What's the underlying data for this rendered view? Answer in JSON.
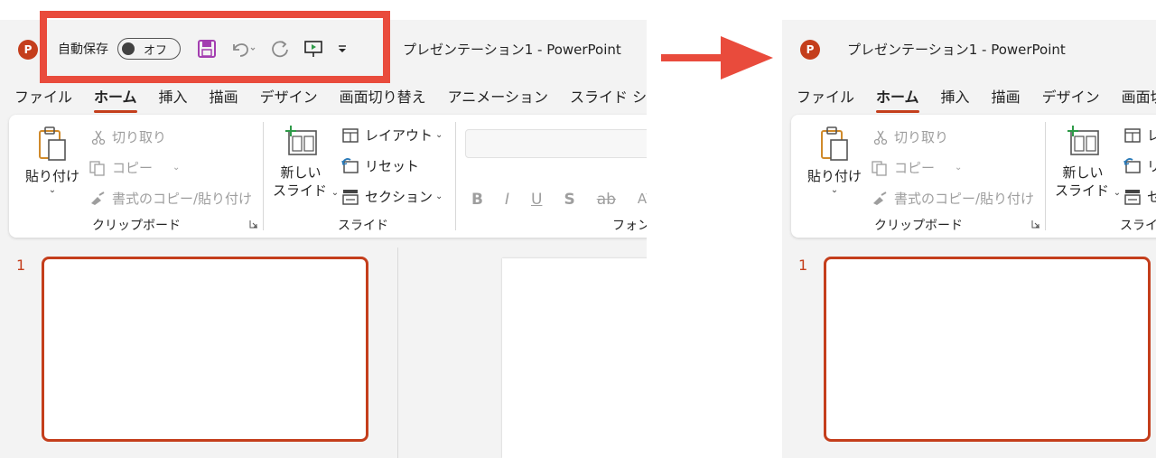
{
  "app": {
    "logo_letter": "P",
    "title": "プレゼンテーション1 - PowerPoint"
  },
  "qat": {
    "autosave_label": "自動保存",
    "autosave_state": "オフ",
    "icons": [
      "save-icon",
      "undo-icon",
      "redo-icon",
      "present-from-start-icon",
      "customize-qat-icon"
    ]
  },
  "tabs": [
    "ファイル",
    "ホーム",
    "挿入",
    "描画",
    "デザイン",
    "画面切り替え",
    "アニメーション",
    "スライド ショー"
  ],
  "tabs_right": [
    "ファイル",
    "ホーム",
    "挿入",
    "描画",
    "デザイン",
    "画面切"
  ],
  "active_tab": "ホーム",
  "ribbon": {
    "clipboard": {
      "paste": "貼り付け",
      "cut": "切り取り",
      "copy": "コピー",
      "format_painter": "書式のコピー/貼り付け",
      "group_label": "クリップボード"
    },
    "slides": {
      "new_slide_line1": "新しい",
      "new_slide_line2": "スライド",
      "layout": "レイアウト",
      "reset": "リセット",
      "section": "セクション",
      "group_label": "スライド"
    },
    "font": {
      "bold": "B",
      "italic": "I",
      "underline": "U",
      "shadow": "S",
      "strikethrough": "ab",
      "spacing": "AV",
      "group_label": "フォン"
    }
  },
  "right_ribbon": {
    "layout_partial": "レ",
    "reset_partial": "リ",
    "section_partial": "セ",
    "group_partial": "スライ"
  },
  "thumbnail": {
    "number": "1"
  },
  "colors": {
    "accent": "#c43e1c",
    "highlight": "#e94b3c",
    "save_icon": "#a33eb0",
    "new_slide_plus": "#2e9a48",
    "reset_icon": "#2a7ab8"
  }
}
